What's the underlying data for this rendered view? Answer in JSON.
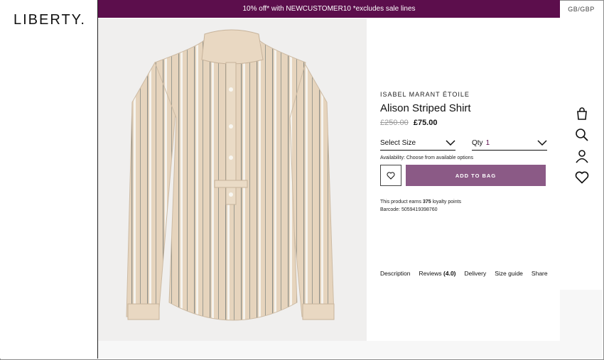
{
  "brand": {
    "logo_text": "LIBERTY."
  },
  "promo": {
    "text": "10% off* with NEWCUSTOMER10 *excludes sale lines"
  },
  "locale": {
    "label": "GB/GBP"
  },
  "product": {
    "designer": "ISABEL MARANT ÉTOILE",
    "name": "Alison Striped Shirt",
    "old_price": "£250.00",
    "price": "£75.00",
    "size_label": "Select Size",
    "qty_label": "Qty",
    "qty_value": "1",
    "availability": "Availability: Choose from available options",
    "add_to_bag": "ADD TO BAG",
    "loyalty_prefix": "This product earns",
    "loyalty_points": "375",
    "loyalty_suffix": "loyalty points",
    "barcode": "Barcode: 5059419398760",
    "image_icon": "striped-shirt-image"
  },
  "tabs": [
    {
      "label": "Description"
    },
    {
      "label": "Reviews",
      "extra": "(4.0)"
    },
    {
      "label": "Delivery"
    },
    {
      "label": "Size guide"
    },
    {
      "label": "Share"
    }
  ],
  "side_icons": [
    "bag-icon",
    "search-icon",
    "account-icon",
    "wishlist-icon"
  ],
  "colors": {
    "promo_bg": "#5c0e4c",
    "add_button": "#8b5a86",
    "image_bg": "#f0efee"
  }
}
